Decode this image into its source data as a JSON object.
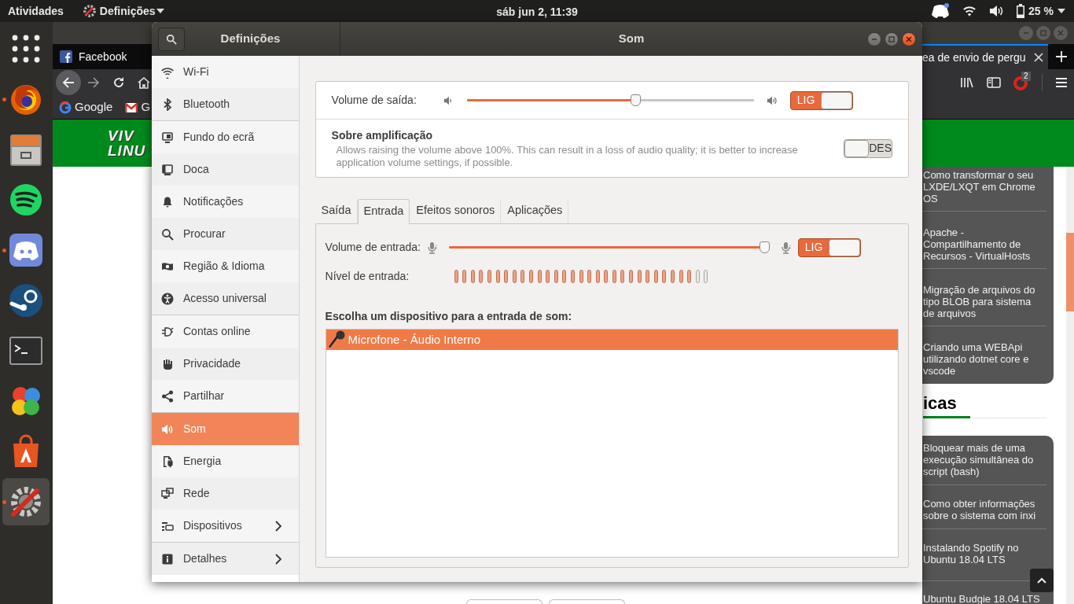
{
  "top_bar": {
    "activities": "Atividades",
    "app_menu": "Definições",
    "clock": "sáb jun  2, 11:39",
    "battery": "25 %"
  },
  "dock": [
    {
      "running": false,
      "selected": false
    },
    {
      "running": true,
      "selected": false
    },
    {
      "running": false,
      "selected": false
    },
    {
      "running": false,
      "selected": false
    },
    {
      "running": true,
      "selected": false
    },
    {
      "running": false,
      "selected": false
    },
    {
      "running": false,
      "selected": false
    },
    {
      "running": false,
      "selected": false
    },
    {
      "running": false,
      "selected": false
    },
    {
      "running": true,
      "selected": true
    }
  ],
  "browser": {
    "tabs": [
      {
        "title": "Facebook",
        "selected": false
      },
      {
        "title": "ea de envio de pergu",
        "selected": true
      }
    ],
    "bookmarks": [
      "Google",
      "G"
    ],
    "extension_badge": "2",
    "logo": [
      "VIV",
      "LINU"
    ],
    "cards": [
      {
        "links": [
          "Como transformar o seu LXDE/LXQT em Chrome OS",
          "Apache - Compartilhamento de Recursos - VirtualHosts",
          "Migração de arquivos do tipo BLOB para sistema de arquivos",
          "Criando uma WEBApi utilizando dotnet core e vscode"
        ]
      },
      {
        "heading": "icas",
        "links": [
          "Bloquear mais de uma execução simultânea do script (bash)",
          "Como obter informações sobre o sistema com inxi",
          "Instalando Spotify no Ubuntu 18.04 LTS",
          "Ubuntu Budgie 18.04 LTS"
        ]
      }
    ]
  },
  "settings": {
    "title": "Definições",
    "panel_title": "Som",
    "sidebar": [
      {
        "items": [
          {
            "label": "Wi-Fi",
            "selected": false
          },
          {
            "label": "Bluetooth",
            "selected": false
          }
        ]
      },
      {
        "items": [
          {
            "label": "Fundo do ecrã",
            "selected": false
          },
          {
            "label": "Doca",
            "selected": false
          },
          {
            "label": "Notificações",
            "selected": false
          },
          {
            "label": "Procurar",
            "selected": false
          },
          {
            "label": "Região & Idioma",
            "selected": false
          },
          {
            "label": "Acesso universal",
            "selected": false
          }
        ]
      },
      {
        "items": [
          {
            "label": "Contas online",
            "selected": false
          },
          {
            "label": "Privacidade",
            "selected": false
          },
          {
            "label": "Partilhar",
            "selected": false
          }
        ]
      },
      {
        "items": [
          {
            "label": "Som",
            "selected": true
          },
          {
            "label": "Energia",
            "selected": false
          },
          {
            "label": "Rede",
            "selected": false
          },
          {
            "label": "Dispositivos",
            "selected": false,
            "submenu": true
          }
        ]
      },
      {
        "items": [
          {
            "label": "Detalhes",
            "selected": false,
            "submenu": true
          }
        ]
      }
    ],
    "output": {
      "label": "Volume de saída:",
      "level": 0.59,
      "switch": {
        "on": true,
        "text": "LIG"
      }
    },
    "over_amplification": {
      "title": "Sobre amplificação",
      "description": "Allows raising the volume above 100%. This can result in a loss of audio quality; it is better to increase application volume settings, if possible.",
      "switch": {
        "on": false,
        "text": "DES"
      }
    },
    "tabs": [
      {
        "label": "Saída",
        "selected": false
      },
      {
        "label": "Entrada",
        "selected": true
      },
      {
        "label": "Efeitos sonoros",
        "selected": false
      },
      {
        "label": "Aplicações",
        "selected": false
      }
    ],
    "input": {
      "label": "Volume de entrada:",
      "level": 1.0,
      "switch": {
        "on": true,
        "text": "LIG"
      },
      "meter_label": "Nível de entrada:",
      "meter": {
        "level": 0.94
      },
      "device_heading": "Escolha um dispositivo para a entrada de som:",
      "devices": [
        {
          "name": "Microfone - Áudio Interno",
          "selected": true
        }
      ]
    }
  }
}
